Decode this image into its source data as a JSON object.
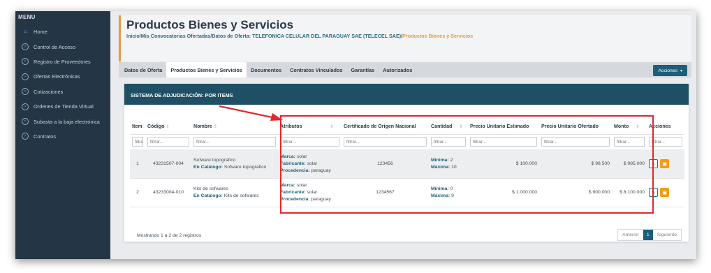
{
  "sidebar": {
    "menu_label": "MENU",
    "items": [
      {
        "label": "Home",
        "icon": "home-icon"
      },
      {
        "label": "Control de Acceso",
        "icon": "chevron-circle-icon"
      },
      {
        "label": "Registro de Proveedores",
        "icon": "chevron-circle-icon"
      },
      {
        "label": "Ofertas Electrónicas",
        "icon": "chevron-circle-icon"
      },
      {
        "label": "Cotizaciones",
        "icon": "chevron-circle-icon"
      },
      {
        "label": "Ordenes de Tienda Virtual",
        "icon": "chevron-circle-icon"
      },
      {
        "label": "Subasta a la baja electrónica",
        "icon": "chevron-circle-icon"
      },
      {
        "label": "Contratos",
        "icon": "chevron-circle-icon"
      }
    ]
  },
  "header": {
    "title": "Productos Bienes y Servicios",
    "breadcrumb": [
      "Inicio",
      "Mis Convocatorias Ofertadas",
      "Datos de Oferta: TELEFONICA CELULAR DEL PARAGUAY SAE (TELECEL SAE)",
      "Productos Bienes y Servicios"
    ],
    "breadcrumb_sep": "/"
  },
  "tabs": [
    {
      "label": "Datos de Oferta",
      "active": false
    },
    {
      "label": "Productos Bienes y Servicios",
      "active": true
    },
    {
      "label": "Documentos",
      "active": false
    },
    {
      "label": "Contratos Vinculados",
      "active": false
    },
    {
      "label": "Garantías",
      "active": false
    },
    {
      "label": "Autorizados",
      "active": false
    }
  ],
  "acciones_label": "Acciones",
  "panel": {
    "title": "SISTEMA DE ADJUDICACIÓN: POR ITEMS"
  },
  "table": {
    "columns": [
      "Item",
      "Código",
      "Nombre",
      "Atributos",
      "Certificado de Origen Nacional",
      "Cantidad",
      "Precio Unitario Estimado",
      "Precio Unitario Ofertado",
      "Monto",
      "Acciones"
    ],
    "filter_placeholder": "filtrar...",
    "filter_placeholder_short": "filtra",
    "labels": {
      "en_catalogo": "En Catálogo:",
      "marca": "Marca:",
      "fabricante": "Fabricante:",
      "procedencia": "Procedencia:",
      "minima": "Mínima:",
      "maxima": "Máxima:"
    },
    "rows": [
      {
        "item": "1",
        "codigo": "43231507-004",
        "nombre": "Sofware topografico",
        "catalogo": "Sofware topografico",
        "marca": "solar",
        "fabricante": "solar",
        "procedencia": "paraguay",
        "certificado": "123456",
        "minima": "2",
        "maxima": "10",
        "precio_estimado": "$ 100.000",
        "precio_ofertado": "$ 98.500",
        "monto": "$ 985.000"
      },
      {
        "item": "2",
        "codigo": "43233004-010",
        "nombre": "Kits de sofwares",
        "catalogo": "Kits de sofwares",
        "marca": "solar",
        "fabricante": "solar",
        "procedencia": "paraguay",
        "certificado": "1234567",
        "minima": "0",
        "maxima": "9",
        "precio_estimado": "$ 1.000.000",
        "precio_ofertado": "$ 900.000",
        "monto": "$ 8.100.000"
      }
    ]
  },
  "footer": {
    "showing": "Mostrando 1 a 2 de 2 registros",
    "prev": "Anterior",
    "page": "1",
    "next": "Siguiente"
  },
  "colors": {
    "sidebar": "#243545",
    "accent": "#e59a45",
    "primary": "#1b5f7a",
    "annotation": "#e0282b"
  }
}
